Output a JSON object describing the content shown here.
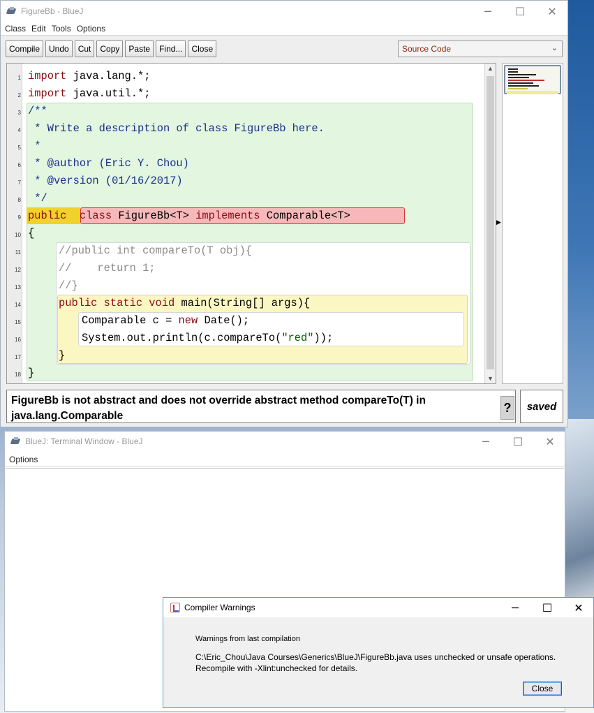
{
  "editor": {
    "title": "FigureBb - BlueJ",
    "menu": [
      "Class",
      "Edit",
      "Tools",
      "Options"
    ],
    "toolbar": [
      "Compile",
      "Undo",
      "Cut",
      "Copy",
      "Paste",
      "Find...",
      "Close"
    ],
    "view_selector": "Source Code",
    "line_numbers": [
      "1",
      "2",
      "3",
      "4",
      "5",
      "6",
      "7",
      "8",
      "9",
      "10",
      "11",
      "12",
      "13",
      "14",
      "15",
      "16",
      "17",
      "18"
    ],
    "code": {
      "l1_kw": "import",
      "l1_rest": " java.lang.*;",
      "l2_kw": "import",
      "l2_rest": " java.util.*;",
      "l3": "/**",
      "l4": " * Write a description of class FigureBb here.",
      "l5": " *",
      "l6": " * @author (Eric Y. Chou)",
      "l7": " * @version (01/16/2017)",
      "l8": " */",
      "l9_public": "public",
      "l9_class": "class",
      "l9_name": " FigureBb<T> ",
      "l9_implements": "implements",
      "l9_iface": " Comparable<T>",
      "l10": "{",
      "l11": "//public int compareTo(T obj){",
      "l12": "//    return 1;",
      "l13": "//}",
      "l14_kw1": "public static void",
      "l14_rest": " main(String[] args){",
      "l15_a": "Comparable c = ",
      "l15_new": "new",
      "l15_b": " Date();",
      "l16_a": "System.out.println(c.compareTo(",
      "l16_str": "\"red\"",
      "l16_b": "));",
      "l17": "}",
      "l18": "}"
    },
    "status_message": "FigureBb is not abstract and does not override abstract method compareTo(T) in java.lang.Comparable",
    "help_label": "?",
    "saved_label": "saved"
  },
  "terminal": {
    "title": "BlueJ: Terminal Window - BlueJ",
    "menu": [
      "Options"
    ]
  },
  "warnings_dialog": {
    "title": "Compiler Warnings",
    "heading": "Warnings from last compilation",
    "message_line1": "C:\\Eric_Chou\\Java Courses\\Generics\\BlueJ\\FigureBb.java uses unchecked or unsafe operations.",
    "message_line2": "Recompile with -Xlint:unchecked for details.",
    "close_label": "Close"
  },
  "window_controls": {
    "minimize": "─",
    "maximize": "☐",
    "close": "✕"
  },
  "colors": {
    "class_scope": "#e2f6e0",
    "method_scope": "#fbf7c3",
    "error_highlight": "#f6b8b8",
    "keyword": "#8b0a14",
    "comment": "#1a2f8a"
  }
}
